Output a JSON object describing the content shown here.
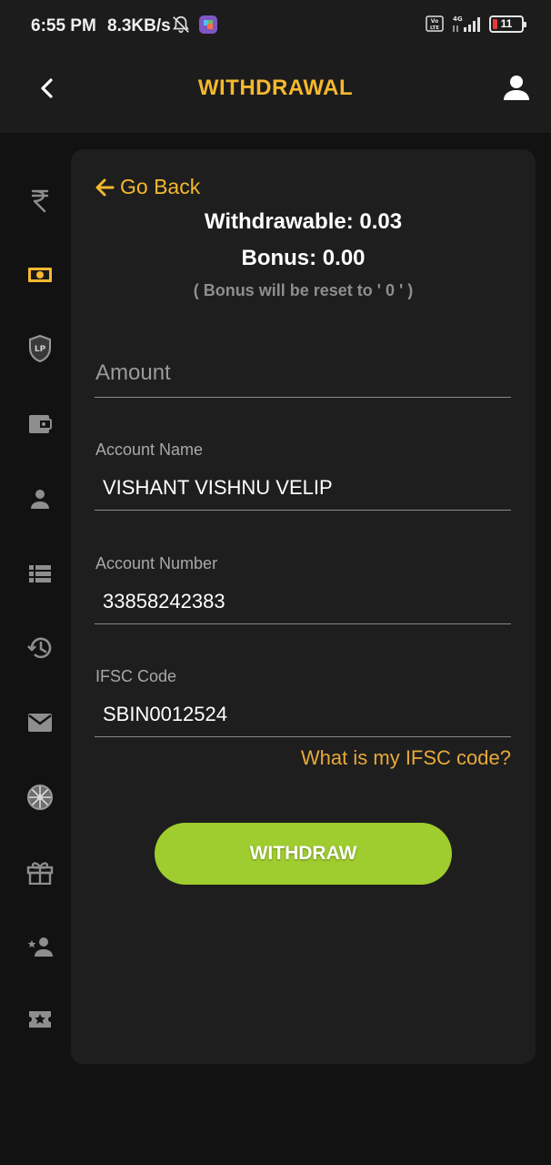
{
  "status_bar": {
    "time": "6:55 PM",
    "speed": "8.3KB/s",
    "network": "4G",
    "volte": "Vo LTE",
    "battery": "11"
  },
  "header": {
    "title": "WITHDRAWAL",
    "accent_color": "#f5b82e"
  },
  "sidebar": {
    "items": [
      {
        "icon": "rupee-icon",
        "active": false
      },
      {
        "icon": "cash-icon",
        "active": true
      },
      {
        "icon": "lp-shield-icon",
        "active": false
      },
      {
        "icon": "wallet-icon",
        "active": false
      },
      {
        "icon": "person-icon",
        "active": false
      },
      {
        "icon": "list-icon",
        "active": false
      },
      {
        "icon": "history-icon",
        "active": false
      },
      {
        "icon": "mail-icon",
        "active": false
      },
      {
        "icon": "spinner-wheel-icon",
        "active": false
      },
      {
        "icon": "gift-icon",
        "active": false
      },
      {
        "icon": "star-person-icon",
        "active": false
      },
      {
        "icon": "ticket-star-icon",
        "active": false
      }
    ]
  },
  "card": {
    "go_back": "Go Back",
    "withdrawable": "Withdrawable: 0.03",
    "bonus": "Bonus: 0.00",
    "bonus_note": "( Bonus will be reset to ' 0 ' )",
    "amount_placeholder": "Amount",
    "account_name_label": "Account Name",
    "account_name_value": "VISHANT VISHNU VELIP",
    "account_number_label": "Account Number",
    "account_number_value": "33858242383",
    "ifsc_label": "IFSC Code",
    "ifsc_value": "SBIN0012524",
    "ifsc_help": "What is my IFSC code?",
    "withdraw_button": "WITHDRAW",
    "button_color": "#9fcc2e"
  }
}
